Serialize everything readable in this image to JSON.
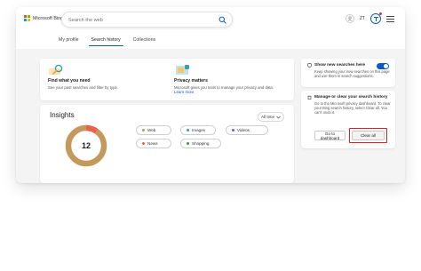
{
  "header": {
    "logo_text": "Microsoft Bing",
    "search_placeholder": "Search the web",
    "lang_label": "ZT",
    "icons": [
      "search-icon",
      "avatar-icon",
      "rewards-icon",
      "menu-icon"
    ]
  },
  "tabs": [
    {
      "label": "My profile",
      "active": false
    },
    {
      "label": "Search history",
      "active": true
    },
    {
      "label": "Collections",
      "active": false
    }
  ],
  "features": [
    {
      "title": "Find what you need",
      "desc": "See your past searches and filter by type.",
      "link": ""
    },
    {
      "title": "Privacy matters",
      "desc": "Microsoft gives you tools to manage your privacy and data.",
      "link": "Learn more"
    }
  ],
  "insights": {
    "title": "Insights",
    "filter_label": "All time",
    "total_count": "12",
    "donut_segments": [
      {
        "category": "News",
        "fraction": 0.1,
        "color": "#e8634a"
      },
      {
        "category": "Web",
        "fraction": 0.9,
        "color": "#c49a5c"
      }
    ],
    "categories": [
      {
        "label": "Web",
        "color": "#c49a5c"
      },
      {
        "label": "Images",
        "color": "#3aa0a8"
      },
      {
        "label": "Videos",
        "color": "#5b6bd6"
      },
      {
        "label": "News",
        "color": "#e8634a"
      },
      {
        "label": "Shopping",
        "color": "#3d9b4c"
      }
    ]
  },
  "side": {
    "new_searches": {
      "title": "Show new searches here",
      "desc": "Keep showing your new searches on this page and use them in search suggestions.",
      "toggle_on": true
    },
    "manage": {
      "title": "Manage or clear your search history",
      "desc": "Go to the Microsoft privacy dashboard. To clear your Bing search history, select Clear all. You can't undo it.",
      "dashboard_label": "Go to dashboard",
      "clear_label": "Clear all"
    }
  },
  "colors": {
    "accent": "#0b57d0",
    "highlight": "#e02020",
    "background": "#f4f4f4"
  }
}
